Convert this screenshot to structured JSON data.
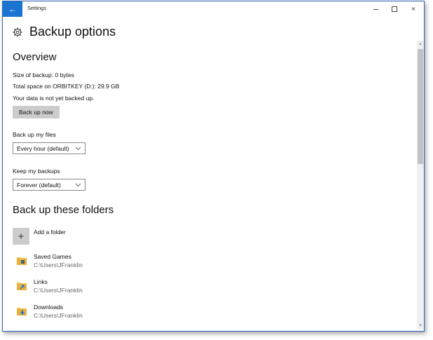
{
  "window": {
    "title": "Settings",
    "back_glyph": "←",
    "controls": {
      "minimize": "minimize",
      "maximize": "maximize",
      "close": "×"
    }
  },
  "page": {
    "title": "Backup options",
    "icon": "gear-icon"
  },
  "overview": {
    "heading": "Overview",
    "size_of_backup": "Size of backup: 0 bytes",
    "total_space": "Total space on ORBITKEY (D:): 29.9 GB",
    "status": "Your data is not yet backed up.",
    "backup_now_label": "Back up now"
  },
  "frequency": {
    "label": "Back up my files",
    "selected": "Every hour (default)"
  },
  "retention": {
    "label": "Keep my backups",
    "selected": "Forever (default)"
  },
  "folders": {
    "heading": "Back up these folders",
    "add_label": "Add a folder",
    "add_glyph": "+",
    "items": [
      {
        "name": "Saved Games",
        "path": "C:\\Users\\JFranklin",
        "icon": "saved-games-folder-icon"
      },
      {
        "name": "Links",
        "path": "C:\\Users\\JFranklin",
        "icon": "links-folder-icon"
      },
      {
        "name": "Downloads",
        "path": "C:\\Users\\JFranklin",
        "icon": "downloads-folder-icon"
      }
    ]
  },
  "colors": {
    "accent": "#1a74d2",
    "window_border": "#2b63b8",
    "button_gray": "#cccccc",
    "folder_yellow": "#f2c14e",
    "arrow_blue": "#2a78d6"
  }
}
